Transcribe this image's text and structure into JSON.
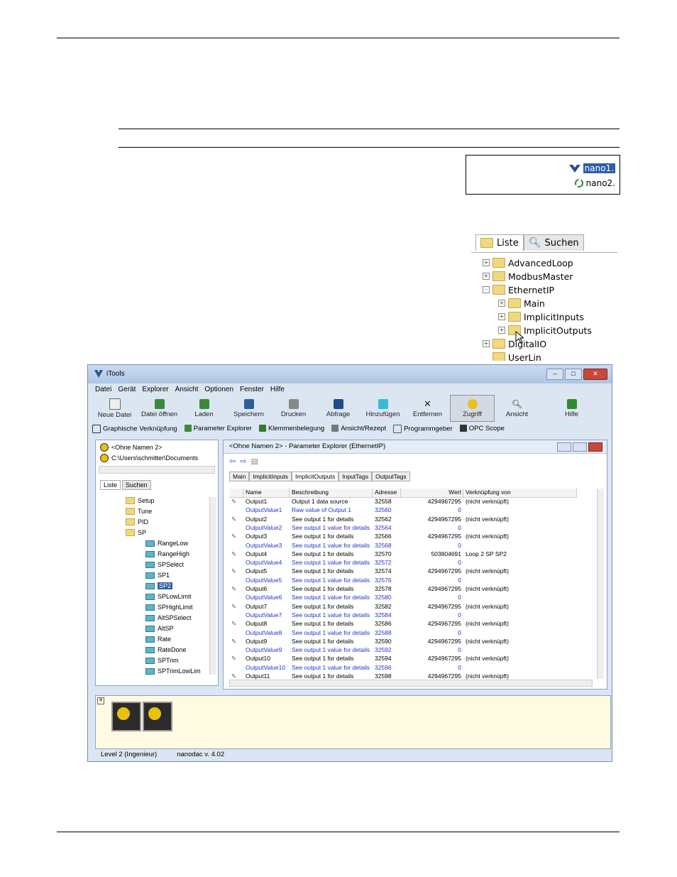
{
  "nano_box": {
    "item1": "nano1.",
    "item2": "nano2."
  },
  "tree_crop": {
    "tab_list": "Liste",
    "tab_search": "Suchen",
    "items": [
      {
        "label": "AdvancedLoop",
        "sign": "+"
      },
      {
        "label": "ModbusMaster",
        "sign": "+"
      },
      {
        "label": "EthernetIP",
        "sign": "-"
      },
      {
        "label": "Main",
        "sign": "+"
      },
      {
        "label": "ImplicitInputs",
        "sign": "+"
      },
      {
        "label": "ImplicitOutputs",
        "sign": "+"
      },
      {
        "label": "DigitalIO",
        "sign": "+"
      },
      {
        "label": "UserLin",
        "sign": ""
      }
    ]
  },
  "app": {
    "title": "iTools",
    "menu": [
      "Datei",
      "Gerät",
      "Explorer",
      "Ansicht",
      "Optionen",
      "Fenster",
      "Hilfe"
    ],
    "toolbar": [
      "Neue Datei",
      "Datei öffnen",
      "Laden",
      "Speichern",
      "Drucken",
      "Abfrage",
      "Hinzufügen",
      "Entfernen",
      "Zugriff",
      "Ansicht",
      "Hilfe"
    ],
    "linkbar": [
      "Graphische Verknüpfung",
      "Parameter Explorer",
      "Klemmenbelegung",
      "Ansicht/Rezept",
      "Programmgeber",
      "OPC Scope"
    ],
    "left": {
      "device1": "<Ohne Namen 2>",
      "device2": "C:\\Users\\schmitter\\Documents",
      "tab_list": "Liste",
      "tab_search": "Suchen",
      "tree": [
        "Setup",
        "Tune",
        "PID",
        "SP",
        "RangeLow",
        "RangeHigh",
        "SPSelect",
        "SP1",
        "SP2",
        "SPLowLimit",
        "SPHighLimit",
        "AltSPSelect",
        "AltSP",
        "Rate",
        "RateDone",
        "SPTrim",
        "SPTrimLowLim"
      ]
    },
    "explorer": {
      "title": "<Ohne Namen 2> - Parameter Explorer (EthernetIP)",
      "tabs": [
        "Main",
        "ImplicitInputs",
        "ImplicitOutputs",
        "InputTags",
        "OutputTags"
      ],
      "columns": [
        "Name",
        "Beschreibung",
        "Adresse",
        "Wert",
        "Verknüpfung von"
      ],
      "rows": [
        [
          "Output1",
          "Output 1 data source",
          "32558",
          "4294967295",
          "(nicht verknüpft)",
          "p"
        ],
        [
          "OutputValue1",
          "Raw value of Output 1",
          "32560",
          "0",
          "",
          "v"
        ],
        [
          "Output2",
          "See output 1 for details",
          "32562",
          "4294967295",
          "(nicht verknüpft)",
          "p"
        ],
        [
          "OutputValue2",
          "See output 1 value for details",
          "32564",
          "0",
          "",
          "v"
        ],
        [
          "Output3",
          "See output 1 for details",
          "32566",
          "4294967295",
          "(nicht verknüpft)",
          "p"
        ],
        [
          "OutputValue3",
          "See output 1 value for details",
          "32568",
          "0",
          "",
          "v"
        ],
        [
          "Output4",
          "See output 1 for details",
          "32570",
          "503804691",
          "Loop 2 SP SP2",
          "p"
        ],
        [
          "OutputValue4",
          "See output 1 value for details",
          "32572",
          "0",
          "",
          "v"
        ],
        [
          "Output5",
          "See output 1 for details",
          "32574",
          "4294967295",
          "(nicht verknüpft)",
          "p"
        ],
        [
          "OutputValue5",
          "See output 1 value for details",
          "32576",
          "0",
          "",
          "v"
        ],
        [
          "Output6",
          "See output 1 for details",
          "32578",
          "4294967295",
          "(nicht verknüpft)",
          "p"
        ],
        [
          "OutputValue6",
          "See output 1 value for details",
          "32580",
          "0",
          "",
          "v"
        ],
        [
          "Output7",
          "See output 1 for details",
          "32582",
          "4294967295",
          "(nicht verknüpft)",
          "p"
        ],
        [
          "OutputValue7",
          "See output 1 value for details",
          "32584",
          "0",
          "",
          "v"
        ],
        [
          "Output8",
          "See output 1 for details",
          "32586",
          "4294967295",
          "(nicht verknüpft)",
          "p"
        ],
        [
          "OutputValue8",
          "See output 1 value for details",
          "32588",
          "0",
          "",
          "v"
        ],
        [
          "Output9",
          "See output 1 for details",
          "32590",
          "4294967295",
          "(nicht verknüpft)",
          "p"
        ],
        [
          "OutputValue9",
          "See output 1 value for details",
          "32592",
          "0",
          "",
          "v"
        ],
        [
          "Output10",
          "See output 1 for details",
          "32594",
          "4294967295",
          "(nicht verknüpft)",
          "p"
        ],
        [
          "OutputValue10",
          "See output 1 value for details",
          "32596",
          "0",
          "",
          "v"
        ],
        [
          "Output11",
          "See output 1 for details",
          "32598",
          "4294967295",
          "(nicht verknüpft)",
          "p"
        ]
      ]
    },
    "status": {
      "level": "Level 2 (Ingenieur)",
      "version": "nanodac v. 4.02"
    },
    "colors": {
      "link_blue": "#2233cc",
      "title_bg": "#aec6e3",
      "pane_border": "#8fa3bf"
    }
  }
}
